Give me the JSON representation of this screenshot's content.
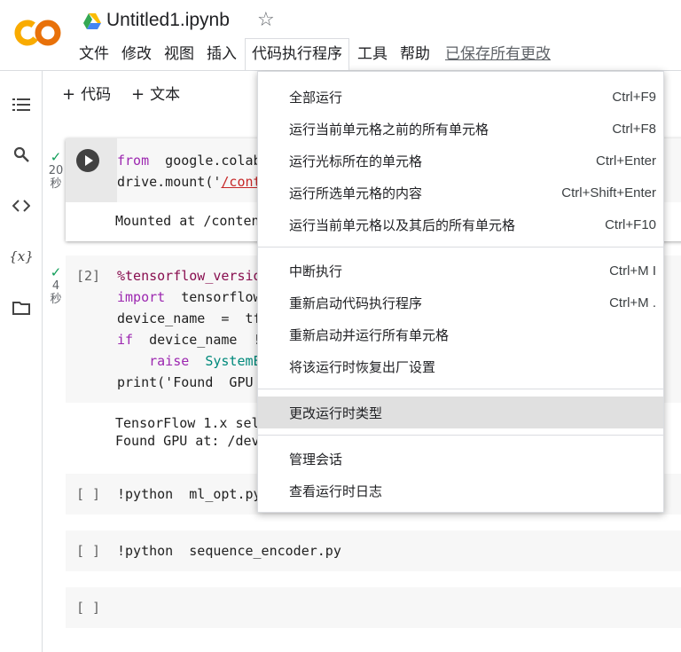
{
  "app": {
    "title": "Untitled1.ipynb",
    "logo_text": "CO",
    "brand_colors": {
      "orange": "#F9AB00",
      "dark_orange": "#E8710A"
    }
  },
  "menubar": {
    "items": [
      "文件",
      "修改",
      "视图",
      "插入",
      "代码执行程序",
      "工具",
      "帮助"
    ],
    "active_index": 4,
    "save_status": "已保存所有更改"
  },
  "toolbar": {
    "add_code": "代码",
    "add_text": "文本"
  },
  "left_rail": [
    "toc-icon",
    "search-icon",
    "code-snippets-icon",
    "variables-icon",
    "files-icon"
  ],
  "left_rail_labels": {
    "variables": "{x}"
  },
  "cells": [
    {
      "status_time": "20",
      "status_unit": "秒",
      "code": [
        "from  google.colab",
        "drive.mount('/cont"
      ],
      "output": [
        "Mounted at /conten"
      ]
    },
    {
      "exec_count": "[2]",
      "status_time": "4",
      "status_unit": "秒",
      "code": [
        "%tensorflow_versio",
        "import  tensorflow",
        "device_name  =  tf",
        "if  device_name  !",
        "    raise  SystemE",
        "print('Found  GPU"
      ],
      "output": [
        "TensorFlow 1.x sel",
        "Found GPU at: /dev"
      ]
    },
    {
      "exec_count": "[ ]",
      "code": [
        "!python  ml_opt.py"
      ]
    },
    {
      "exec_count": "[ ]",
      "code": [
        "!python  sequence_encoder.py"
      ]
    },
    {
      "exec_count": "[ ]",
      "code": [
        ""
      ]
    }
  ],
  "dropdown": {
    "groups": [
      [
        {
          "label": "全部运行",
          "shortcut": "Ctrl+F9"
        },
        {
          "label": "运行当前单元格之前的所有单元格",
          "shortcut": "Ctrl+F8"
        },
        {
          "label": "运行光标所在的单元格",
          "shortcut": "Ctrl+Enter"
        },
        {
          "label": "运行所选单元格的内容",
          "shortcut": "Ctrl+Shift+Enter"
        },
        {
          "label": "运行当前单元格以及其后的所有单元格",
          "shortcut": "Ctrl+F10"
        }
      ],
      [
        {
          "label": "中断执行",
          "shortcut": "Ctrl+M I"
        },
        {
          "label": "重新启动代码执行程序",
          "shortcut": "Ctrl+M ."
        },
        {
          "label": "重新启动并运行所有单元格",
          "shortcut": ""
        },
        {
          "label": "将该运行时恢复出厂设置",
          "shortcut": ""
        }
      ],
      [
        {
          "label": "更改运行时类型",
          "shortcut": "",
          "highlighted": true
        }
      ],
      [
        {
          "label": "管理会话",
          "shortcut": ""
        },
        {
          "label": "查看运行时日志",
          "shortcut": ""
        }
      ]
    ]
  }
}
